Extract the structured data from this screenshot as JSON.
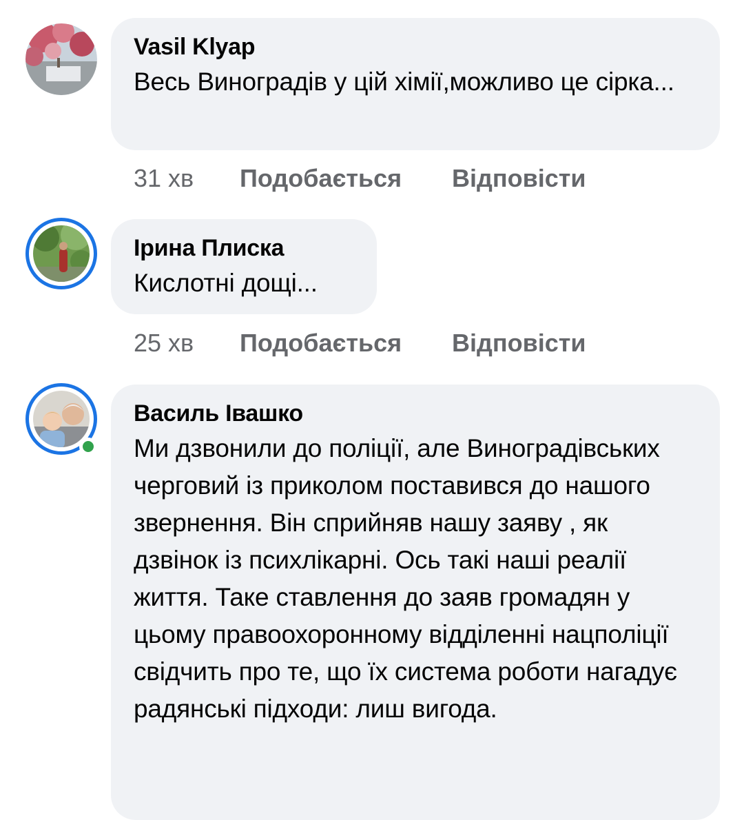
{
  "comments": [
    {
      "author": "Vasil Klyap",
      "text": "Весь Виноградів у цій хімії,можливо це сірка...",
      "time": "31 хв",
      "like_label": "Подобається",
      "reply_label": "Відповісти"
    },
    {
      "author": "Ірина Плиска",
      "text": "Кислотні дощі...",
      "time": "25 хв",
      "like_label": "Подобається",
      "reply_label": "Відповісти"
    },
    {
      "author": "Василь Івашко",
      "text": "Ми дзвонили до поліції, але Виноградівських черговий із приколом поставився до нашого звернення. Він сприйняв нашу заяву , як дзвінок із психлікарні. Ось такі наші реалії життя. Таке ставлення до заяв громадян у цьому правоохоронному відділенні нацполіції свідчить про те, що їх система роботи нагадує радянські підходи: лиш вигода."
    }
  ],
  "colors": {
    "bubble_bg": "#f0f2f5",
    "meta_text": "#65676b",
    "story_ring": "#1b74e4",
    "online": "#31a24c"
  }
}
